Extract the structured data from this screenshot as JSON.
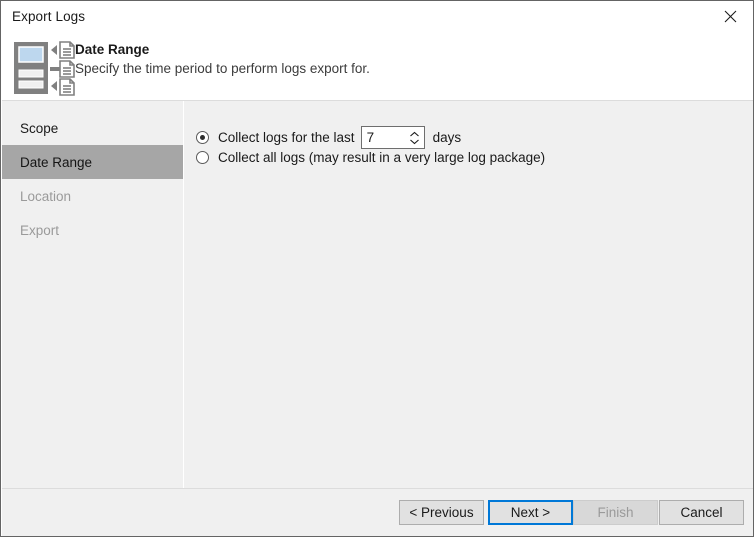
{
  "window": {
    "title": "Export Logs",
    "close_label": "×"
  },
  "header": {
    "title": "Date Range",
    "description": "Specify the time period to perform logs export for.",
    "icon": "export-logs-icon"
  },
  "sidebar": {
    "items": [
      {
        "label": "Scope",
        "state": "normal"
      },
      {
        "label": "Date Range",
        "state": "selected"
      },
      {
        "label": "Location",
        "state": "disabled"
      },
      {
        "label": "Export",
        "state": "disabled"
      }
    ]
  },
  "main": {
    "options": [
      {
        "label_before": "Collect logs for the last",
        "label_after": "days",
        "selected": true,
        "spinner_value": "7"
      },
      {
        "label": "Collect all logs (may result in a very large log package)",
        "selected": false
      }
    ]
  },
  "footer": {
    "previous_label": "< Previous",
    "next_label": "Next >",
    "finish_label": "Finish",
    "cancel_label": "Cancel"
  },
  "colors": {
    "accent": "#0078d7",
    "selected_row": "#a6a6a6",
    "panel_bg": "#f0f0f0",
    "icon_gray": "#808080",
    "icon_screen_blue": "#bdd7ee"
  }
}
